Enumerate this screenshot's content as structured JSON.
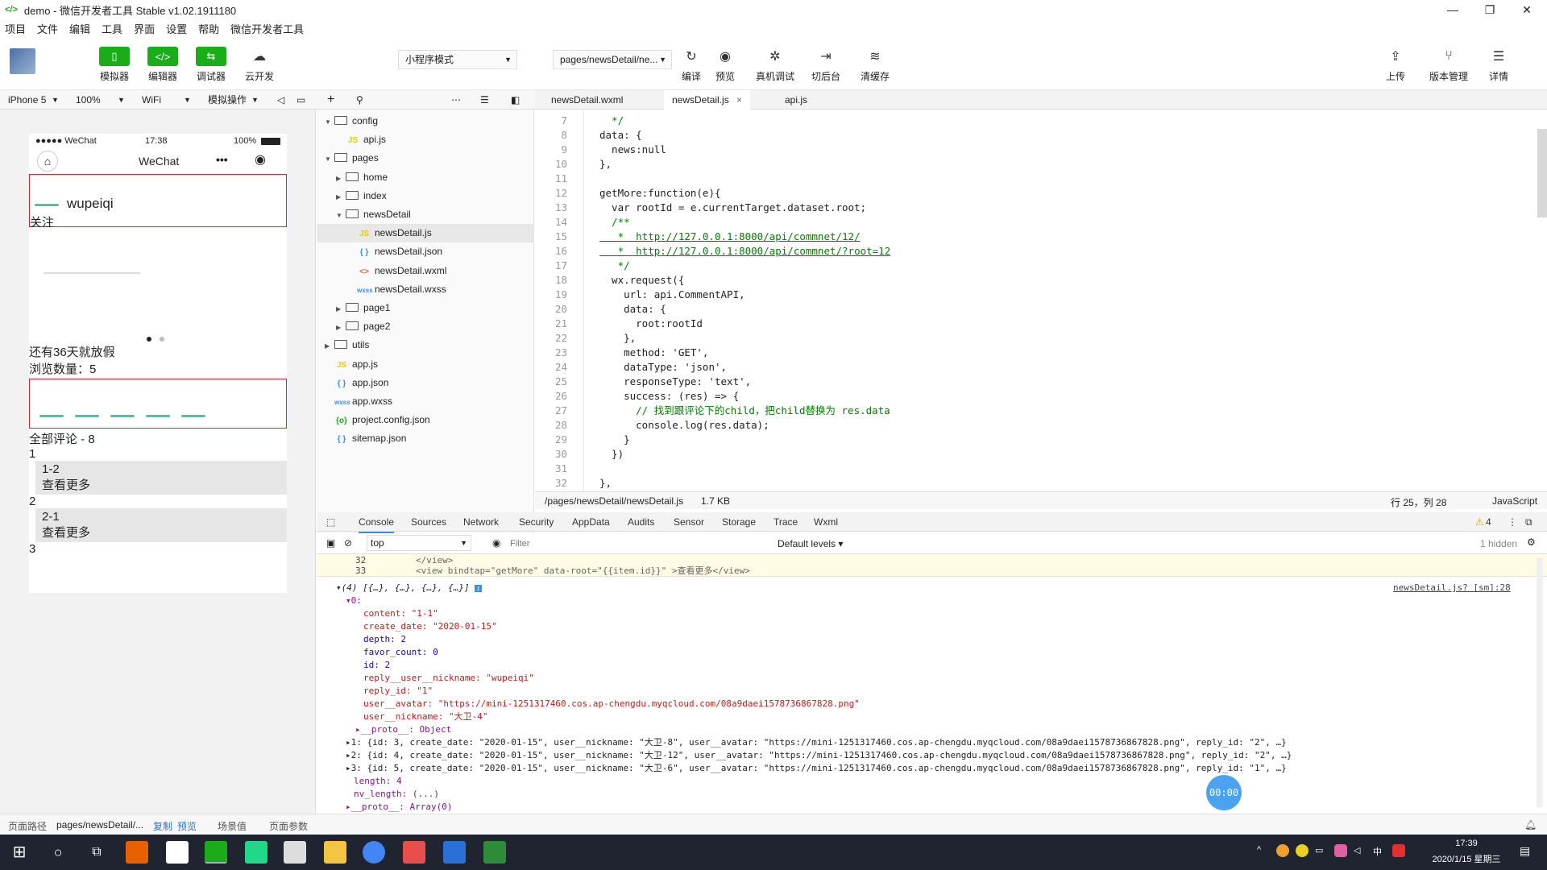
{
  "window": {
    "title": "demo - 微信开发者工具 Stable v1.02.1911180",
    "minimize": "—",
    "maximize": "❐",
    "close": "✕"
  },
  "menu": [
    "项目",
    "文件",
    "编辑",
    "工具",
    "界面",
    "设置",
    "帮助",
    "微信开发者工具"
  ],
  "toolbar": {
    "simulator": "模拟器",
    "editor": "编辑器",
    "debugger": "调试器",
    "cloud": "云开发",
    "mode": "小程序模式",
    "page": "pages/newsDetail/ne...",
    "compile": "编译",
    "preview": "预览",
    "remote_debug": "真机调试",
    "background": "切后台",
    "clear_cache": "清缓存",
    "upload": "上传",
    "version": "版本管理",
    "details": "详情"
  },
  "devbar": {
    "device": "iPhone 5",
    "zoom": "100%",
    "network": "WiFi",
    "sim_ops": "模拟操作"
  },
  "phone": {
    "carrier": "●●●●● WeChat",
    "time": "17:38",
    "battery": "100%",
    "nav_title": "WeChat",
    "nickname": "wupeiqi",
    "follow": "关注",
    "holiday": "还有36天就放假",
    "views": "浏览数量：5",
    "all_comments": "全部评论 - 8",
    "c1": "1",
    "c1_1": "1-2",
    "more1": "查看更多",
    "c2": "2",
    "c2_1": "2-1",
    "more2": "查看更多",
    "c3": "3"
  },
  "tree": [
    {
      "label": "config",
      "type": "folder",
      "open": true,
      "depth": 0
    },
    {
      "label": "api.js",
      "type": "js",
      "depth": 1
    },
    {
      "label": "pages",
      "type": "folder",
      "open": true,
      "depth": 0
    },
    {
      "label": "home",
      "type": "folder",
      "open": false,
      "depth": 1
    },
    {
      "label": "index",
      "type": "folder",
      "open": false,
      "depth": 1
    },
    {
      "label": "newsDetail",
      "type": "folder",
      "open": true,
      "depth": 1
    },
    {
      "label": "newsDetail.js",
      "type": "js",
      "depth": 2,
      "selected": true
    },
    {
      "label": "newsDetail.json",
      "type": "json",
      "depth": 2
    },
    {
      "label": "newsDetail.wxml",
      "type": "wxml",
      "depth": 2
    },
    {
      "label": "newsDetail.wxss",
      "type": "wxss",
      "depth": 2
    },
    {
      "label": "page1",
      "type": "folder",
      "open": false,
      "depth": 1
    },
    {
      "label": "page2",
      "type": "folder",
      "open": false,
      "depth": 1
    },
    {
      "label": "utils",
      "type": "folder",
      "open": false,
      "depth": 0
    },
    {
      "label": "app.js",
      "type": "js",
      "depth": 0
    },
    {
      "label": "app.json",
      "type": "json",
      "depth": 0
    },
    {
      "label": "app.wxss",
      "type": "wxss",
      "depth": 0
    },
    {
      "label": "project.config.json",
      "type": "cfg",
      "depth": 0
    },
    {
      "label": "sitemap.json",
      "type": "json",
      "depth": 0
    }
  ],
  "tabs": [
    "newsDetail.wxml",
    "newsDetail.js",
    "api.js"
  ],
  "tab_close": "×",
  "code": [
    {
      "n": "7",
      "t": "  */"
    },
    {
      "n": "8",
      "t": "data: {"
    },
    {
      "n": "9",
      "t": "  news:null"
    },
    {
      "n": "10",
      "t": "},"
    },
    {
      "n": "11",
      "t": ""
    },
    {
      "n": "12",
      "t": "getMore:function(e){"
    },
    {
      "n": "13",
      "t": "  var rootId = e.currentTarget.dataset.root;"
    },
    {
      "n": "14",
      "t": "  /**"
    },
    {
      "n": "15",
      "t": "   *  http://127.0.0.1:8000/api/commnet/12/"
    },
    {
      "n": "16",
      "t": "   *  http://127.0.0.1:8000/api/commnet/?root=12"
    },
    {
      "n": "17",
      "t": "   */"
    },
    {
      "n": "18",
      "t": "  wx.request({"
    },
    {
      "n": "19",
      "t": "    url: api.CommentAPI,"
    },
    {
      "n": "20",
      "t": "    data: {"
    },
    {
      "n": "21",
      "t": "      root:rootId"
    },
    {
      "n": "22",
      "t": "    },"
    },
    {
      "n": "23",
      "t": "    method: 'GET',"
    },
    {
      "n": "24",
      "t": "    dataType: 'json',"
    },
    {
      "n": "25",
      "t": "    responseType: 'text',"
    },
    {
      "n": "26",
      "t": "    success: (res) => {"
    },
    {
      "n": "27",
      "t": "      // 找到跟评论下的child，把child替换为 res.data"
    },
    {
      "n": "28",
      "t": "      console.log(res.data);"
    },
    {
      "n": "29",
      "t": "    }"
    },
    {
      "n": "30",
      "t": "  })"
    },
    {
      "n": "31",
      "t": ""
    },
    {
      "n": "32",
      "t": "},"
    }
  ],
  "estatus": {
    "path": "/pages/newsDetail/newsDetail.js",
    "size": "1.7 KB",
    "pos": "行 25，列 28",
    "lang": "JavaScript"
  },
  "devtools_tabs": [
    "Console",
    "Sources",
    "Network",
    "Security",
    "AppData",
    "Audits",
    "Sensor",
    "Storage",
    "Trace",
    "Wxml"
  ],
  "warn_count": "4",
  "console_bar": {
    "context": "top",
    "filter_placeholder": "Filter",
    "levels": "Default levels",
    "hidden": "1 hidden"
  },
  "console": {
    "src1_n": "32",
    "src1": "        </view>",
    "src2_n": "33",
    "src2": "        <view bindtap=\"getMore\" data-root=\"{{item.id}}\" >查看更多</view>",
    "array": "(4) [{…}, {…}, {…}, {…}]",
    "source_link": "newsDetail.js? [sm]:28",
    "item0": "0:",
    "content": "content: \"1-1\"",
    "create_date": "create_date: \"2020-01-15\"",
    "depth": "depth: 2",
    "favor": "favor_count: 0",
    "id": "id: 2",
    "reply_nick": "reply__user__nickname: \"wupeiqi\"",
    "reply_id": "reply_id: \"1\"",
    "avatar": "user__avatar: \"https://mini-1251317460.cos.ap-chengdu.myqcloud.com/08a9daei1578736867828.png\"",
    "nick": "user__nickname: \"大卫-4\"",
    "proto": "__proto__: Object",
    "r1": "1: {id: 3, create_date: \"2020-01-15\", user__nickname: \"大卫-8\", user__avatar: \"https://mini-1251317460.cos.ap-chengdu.myqcloud.com/08a9daei1578736867828.png\", reply_id: \"2\", …}",
    "r2": "2: {id: 4, create_date: \"2020-01-15\", user__nickname: \"大卫-12\", user__avatar: \"https://mini-1251317460.cos.ap-chengdu.myqcloud.com/08a9daei1578736867828.png\", reply_id: \"2\", …}",
    "r3": "3: {id: 5, create_date: \"2020-01-15\", user__nickname: \"大卫-6\", user__avatar: \"https://mini-1251317460.cos.ap-chengdu.myqcloud.com/08a9daei1578736867828.png\", reply_id: \"1\", …}",
    "length": "length: 4",
    "nv_length": "nv_length: (...)",
    "proto2": "__proto__: Array(0)"
  },
  "timer": "00:00",
  "pathbar": {
    "label": "页面路径",
    "path": "pages/newsDetail/...",
    "copy": "复制",
    "preview": "预览",
    "scene": "场景值",
    "params": "页面参数"
  },
  "clock": {
    "time": "17:39",
    "date": "2020/1/15 星期三"
  },
  "ime": "中",
  "colors": {
    "accent": "#1aad19",
    "select": "#3a8ee6",
    "redbox": "#e0232f"
  }
}
